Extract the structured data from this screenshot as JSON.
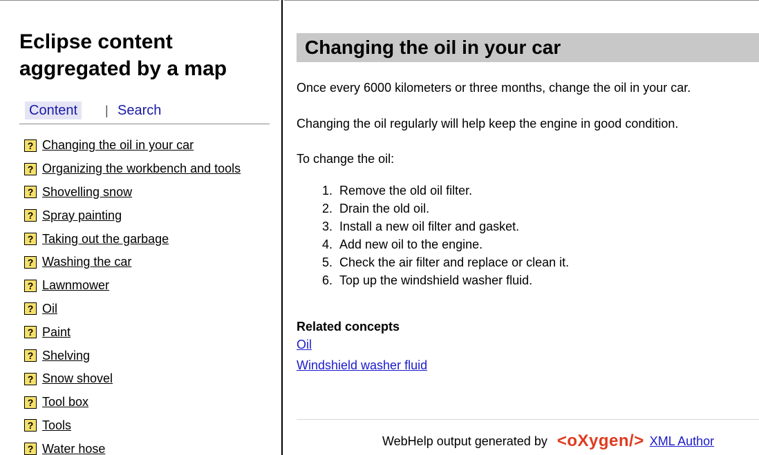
{
  "sidebar": {
    "title": "Eclipse content aggregated by a map",
    "tabs": {
      "content": "Content",
      "separator": "|",
      "search": "Search"
    },
    "toc": [
      "Changing the oil in your car",
      "Organizing the workbench and tools",
      "Shovelling snow",
      "Spray painting",
      "Taking out the garbage",
      "Washing the car",
      "Lawnmower",
      "Oil",
      "Paint",
      "Shelving",
      "Snow shovel",
      "Tool box",
      "Tools",
      "Water hose"
    ],
    "toc_icon_glyph": "?"
  },
  "content": {
    "title": "Changing the oil in your car",
    "intro": "Once every 6000 kilometers or three months, change the oil in your car.",
    "body": "Changing the oil regularly will help keep the engine in good condition.",
    "steps_intro": "To change the oil:",
    "steps": [
      {
        "num": "1.",
        "text": "Remove the old oil filter."
      },
      {
        "num": "2.",
        "text": "Drain the old oil."
      },
      {
        "num": "3.",
        "text": "Install a new oil filter and gasket."
      },
      {
        "num": "4.",
        "text": "Add new oil to the engine."
      },
      {
        "num": "5.",
        "text": "Check the air filter and replace or clean it."
      },
      {
        "num": "6.",
        "text": "Top up the windshield washer fluid."
      }
    ],
    "related_heading": "Related concepts",
    "related_links": [
      "Oil",
      "Windshield washer fluid"
    ]
  },
  "footer": {
    "text": "WebHelp output generated by",
    "logo": "<oXygen/>",
    "link": "XML Author"
  },
  "colors": {
    "link": "#1a1acc",
    "title_band": "#c8c8c8",
    "tab_active_bg": "#e4e4f5",
    "help_icon": "#f5e06b",
    "logo": "#e03a1e"
  }
}
